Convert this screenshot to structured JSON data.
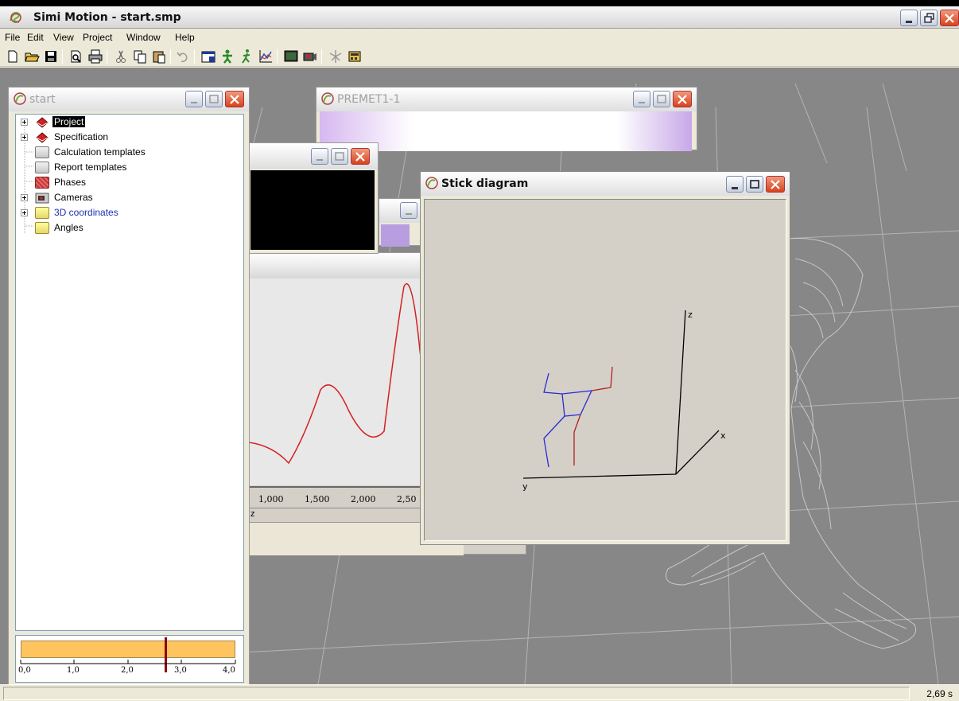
{
  "app": {
    "title": "Simi Motion - start.smp",
    "status_time": "2,69 s"
  },
  "menu": [
    "File",
    "Edit",
    "View",
    "Project",
    "Window",
    "Help"
  ],
  "toolbar_icons": [
    "new-icon",
    "open-icon",
    "save-icon",
    "print-preview-icon",
    "print-icon",
    "cut-icon",
    "copy-icon",
    "paste-icon",
    "undo-icon",
    "window-icon",
    "person-green-icon",
    "person-walk-icon",
    "graph-icon",
    "display-icon",
    "camera-icon",
    "network-icon",
    "calculator-icon"
  ],
  "start_window": {
    "title": "start",
    "tree": [
      {
        "label": "Project",
        "icon": "book",
        "expandable": true,
        "selected": true
      },
      {
        "label": "Specification",
        "icon": "book",
        "expandable": true
      },
      {
        "label": "Calculation templates",
        "icon": "gray-folder"
      },
      {
        "label": "Report templates",
        "icon": "gray-folder"
      },
      {
        "label": "Phases",
        "icon": "red-folder"
      },
      {
        "label": "Cameras",
        "icon": "camera",
        "expandable": true
      },
      {
        "label": "3D coordinates",
        "icon": "folder",
        "expandable": true,
        "blue": true
      },
      {
        "label": "Angles",
        "icon": "folder"
      }
    ],
    "timeline": {
      "ticks": [
        "0,0",
        "1,0",
        "2,0",
        "3,0",
        "4,0"
      ],
      "cursor_value": 2.69
    }
  },
  "premet_window": {
    "title": "PREMET1-1"
  },
  "graph_window": {
    "x_ticks": [
      "1,000",
      "1,500",
      "2,000",
      "2,50"
    ],
    "axis_label": "z"
  },
  "stick_window": {
    "title": "Stick diagram",
    "axis_labels": {
      "z": "z",
      "x": "x",
      "y": "y"
    }
  },
  "colors": {
    "blue_limb": "#2a2ad6",
    "red_limb": "#b02020",
    "graph_line": "#d62020",
    "timeline": "#ffc45e"
  }
}
